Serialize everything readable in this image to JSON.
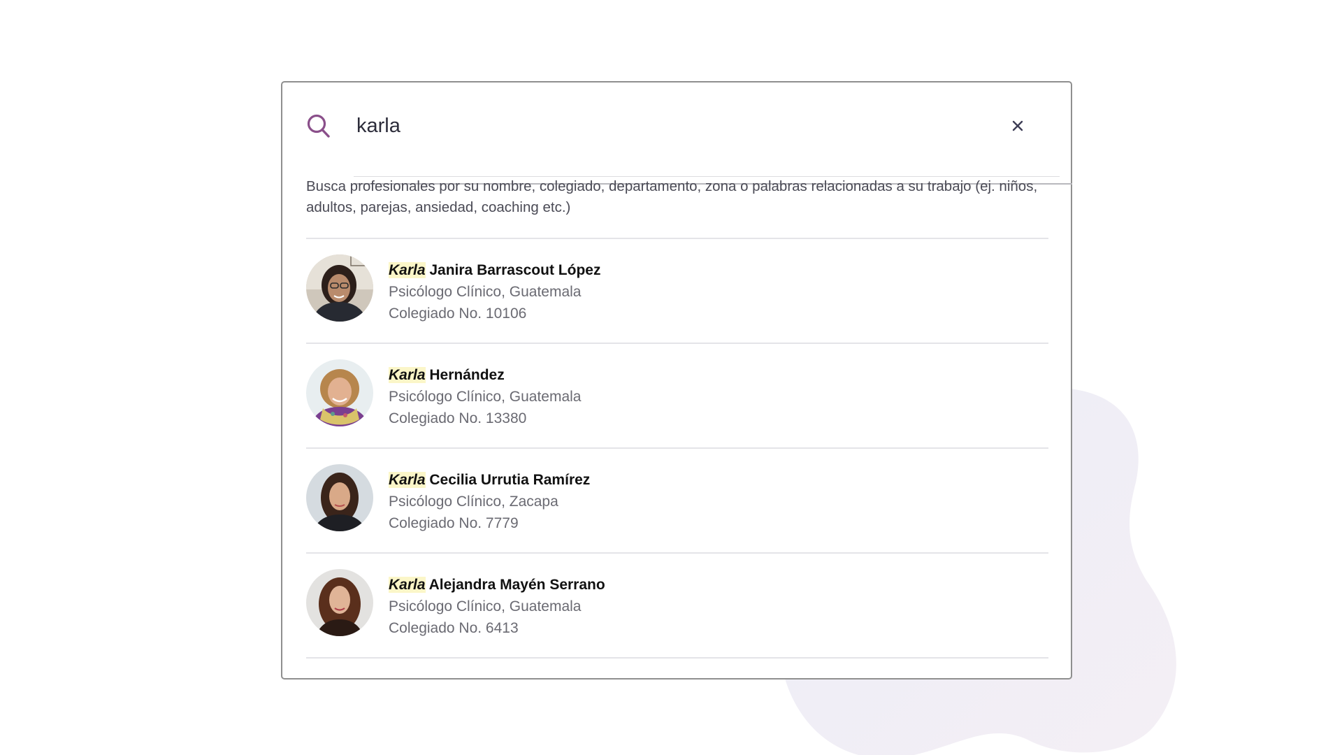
{
  "search": {
    "value": "karla",
    "placeholder": ""
  },
  "help_text": "Busca profesionales por su nombre, colegiado, departamento, zona o palabras relacionadas a su trabajo (ej. niños, adultos, parejas, ansiedad, coaching etc.)",
  "results": [
    {
      "highlight": "Karla",
      "name_rest": " Janira Barrascout López",
      "specialty": "Psicólogo Clínico, Guatemala",
      "colegiado": "Colegiado No. 10106"
    },
    {
      "highlight": "Karla",
      "name_rest": " Hernández",
      "specialty": "Psicólogo Clínico, Guatemala",
      "colegiado": "Colegiado No. 13380"
    },
    {
      "highlight": "Karla",
      "name_rest": " Cecilia Urrutia Ramírez",
      "specialty": "Psicólogo Clínico, Zacapa",
      "colegiado": "Colegiado No. 7779"
    },
    {
      "highlight": "Karla",
      "name_rest": " Alejandra Mayén Serrano",
      "specialty": "Psicólogo Clínico, Guatemala",
      "colegiado": "Colegiado No. 6413"
    }
  ],
  "icons": {
    "search": "search-icon",
    "clear": "close-icon"
  },
  "colors": {
    "accent": "#8a4f8a",
    "clear_icon": "#3d3d55",
    "highlight_bg": "#fbf6c8",
    "border": "#8f8f8f"
  }
}
